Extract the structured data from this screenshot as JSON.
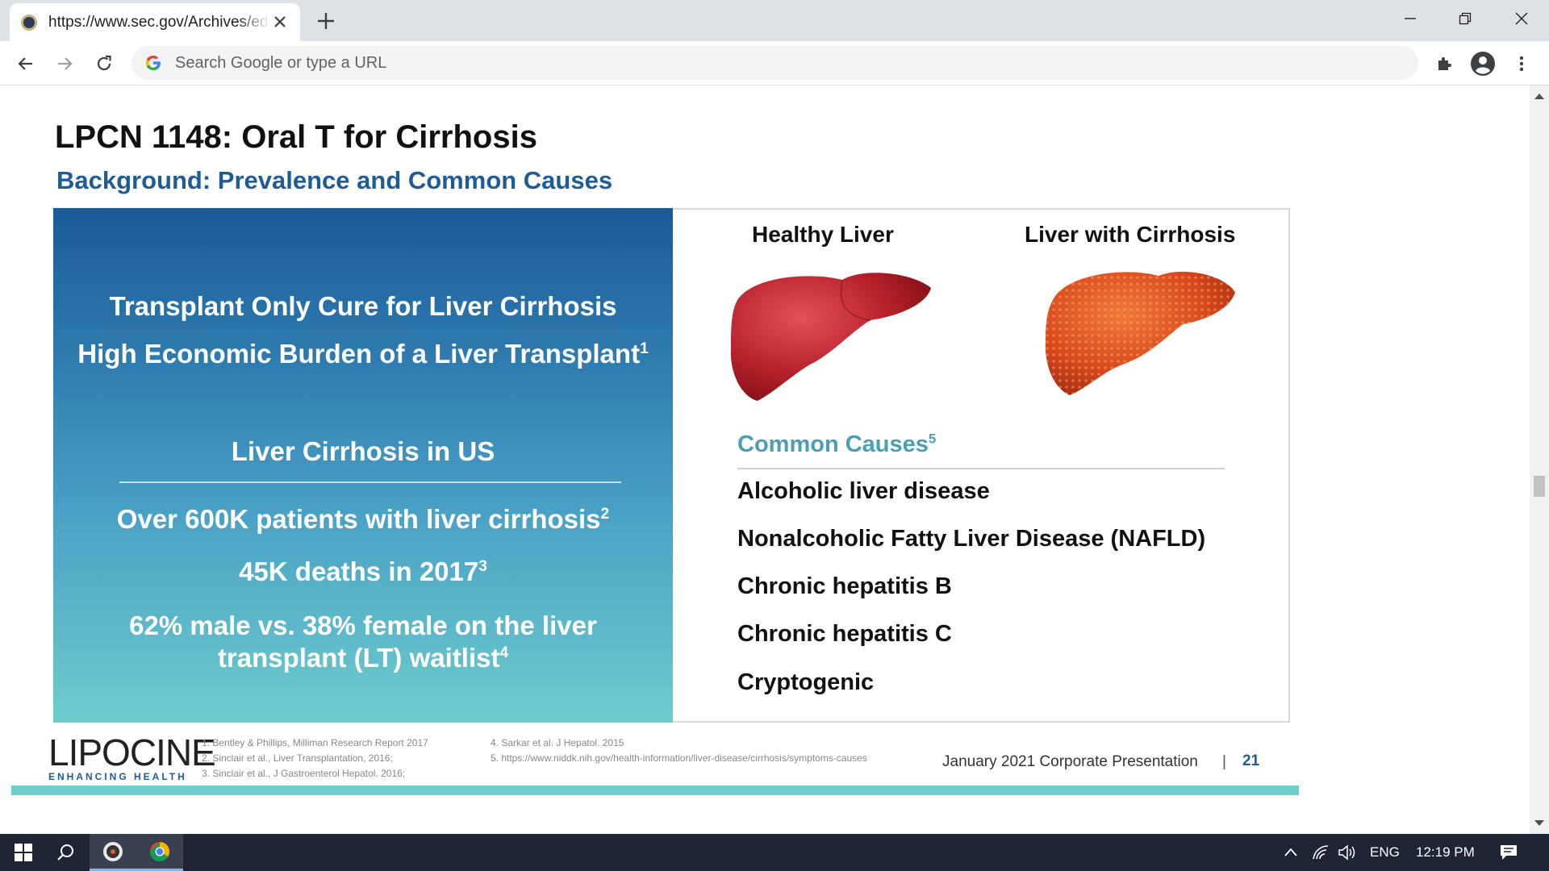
{
  "browser": {
    "tab_title": "https://www.sec.gov/Archives/edgar",
    "omnibox_placeholder": "Search Google or type a URL"
  },
  "slide": {
    "title": "LPCN 1148: Oral T for Cirrhosis",
    "subtitle": "Background: Prevalence and Common Causes",
    "left_panel": {
      "line1": "Transplant Only Cure for Liver Cirrhosis",
      "line2": "High Economic Burden of a Liver Transplant",
      "line2_sup": "1",
      "heading": "Liver Cirrhosis in US",
      "stat1": "Over 600K patients with liver cirrhosis",
      "stat1_sup": "2",
      "stat2": "45K deaths in 2017",
      "stat2_sup": "3",
      "stat3_a": "62% male vs. 38% female on the liver",
      "stat3_b": "transplant (LT) waitlist",
      "stat3_sup": "4"
    },
    "right_panel": {
      "healthy_label": "Healthy Liver",
      "cirrhosis_label": "Liver with Cirrhosis",
      "causes_heading": "Common Causes",
      "causes_sup": "5",
      "causes": [
        "Alcoholic liver disease",
        "Nonalcoholic Fatty Liver Disease (NAFLD)",
        "Chronic hepatitis B",
        "Chronic hepatitis C",
        "Cryptogenic"
      ]
    },
    "logo_main": "LIPOCINE",
    "logo_tag": "ENHANCING HEALTH",
    "references_col1": [
      "1. Bentley & Phillips, Milliman Research Report 2017",
      "2. Sinclair et al., Liver Transplantation, 2016;",
      "3. Sinclair et al., J Gastroenterol Hepatol. 2016;"
    ],
    "references_col2": [
      "4. Sarkar et al. J Hepatol. 2015",
      "5. https://www.niddk.nih.gov/health-information/liver-disease/cirrhosis/symptoms-causes"
    ],
    "footer_text": "January 2021 Corporate Presentation",
    "footer_sep": "|",
    "page_number": "21",
    "colors": {
      "title_blue": "#1f5c96",
      "accent_teal": "#6dcccc",
      "causes_teal": "#4a9fb5"
    }
  },
  "taskbar": {
    "language": "ENG",
    "time": "12:19 PM"
  }
}
